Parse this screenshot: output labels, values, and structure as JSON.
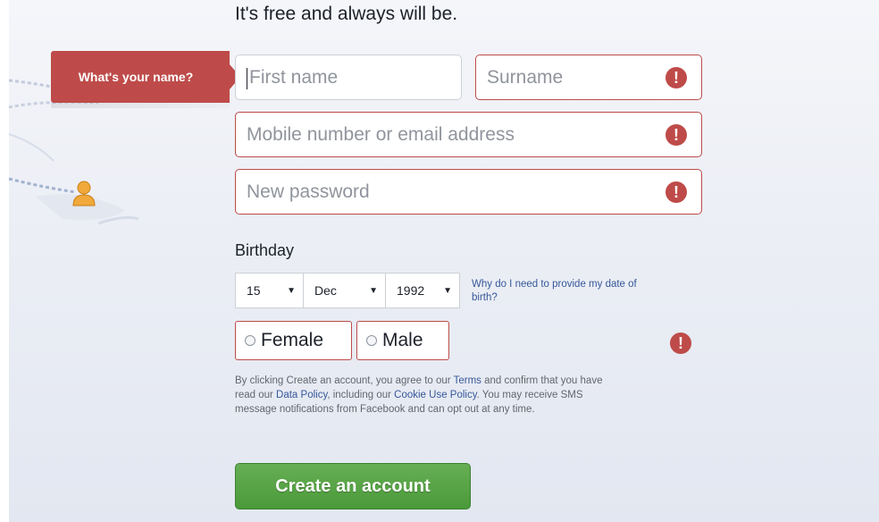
{
  "tagline": "It's free and always will be.",
  "tooltip": {
    "text": "What's your name?"
  },
  "fields": {
    "first_name": {
      "placeholder": "First name"
    },
    "surname": {
      "placeholder": "Surname"
    },
    "contact": {
      "placeholder": "Mobile number or email address"
    },
    "password": {
      "placeholder": "New password"
    }
  },
  "birthday": {
    "label": "Birthday",
    "day": "15",
    "month": "Dec",
    "year": "1992",
    "why_link": "Why do I need to provide my date of birth?"
  },
  "gender": {
    "female": "Female",
    "male": "Male"
  },
  "terms": {
    "part1": "By clicking Create an account, you agree to our ",
    "terms_link": "Terms",
    "part2": " and confirm that you have read our ",
    "data_policy_link": "Data Policy",
    "part3": ", including our ",
    "cookie_link": "Cookie Use Policy",
    "part4": ". You may receive SMS message notifications from Facebook and can opt out at any time."
  },
  "create_button": "Create an account",
  "error_icon_glyph": "!",
  "colors": {
    "error": "#be4b49",
    "link": "#365899",
    "button_green": "#4a9a39"
  }
}
